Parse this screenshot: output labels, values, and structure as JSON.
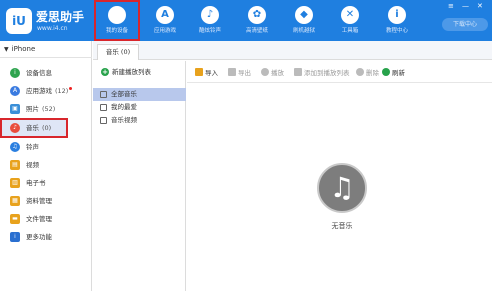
{
  "app": {
    "name": "爱思助手",
    "url": "www.i4.cn"
  },
  "nav": [
    {
      "label": "我的设备",
      "icon": "apple-icon",
      "glyph": ""
    },
    {
      "label": "应用游戏",
      "icon": "app-store-icon",
      "glyph": "A"
    },
    {
      "label": "酷炫铃声",
      "icon": "bell-icon",
      "glyph": "♪"
    },
    {
      "label": "高清壁纸",
      "icon": "wallpaper-icon",
      "glyph": "✿"
    },
    {
      "label": "刷机越狱",
      "icon": "dropbox-icon",
      "glyph": "◆"
    },
    {
      "label": "工具箱",
      "icon": "tools-icon",
      "glyph": "✕"
    },
    {
      "label": "教程中心",
      "icon": "info-icon",
      "glyph": "i"
    }
  ],
  "window_controls": {
    "menu": "≡",
    "minimize": "—",
    "close": "✕"
  },
  "download_button": "下载中心",
  "sidebar": {
    "device": "iPhone",
    "items": [
      {
        "label": "设备信息",
        "count": "",
        "icon": "info-icon",
        "color": "#2ea44f"
      },
      {
        "label": "应用游戏",
        "count": "(12)",
        "icon": "apps-icon",
        "color": "#3a7be0"
      },
      {
        "label": "照片",
        "count": "(52)",
        "icon": "photo-icon",
        "color": "#3a8fd8"
      },
      {
        "label": "音乐",
        "count": "(0)",
        "icon": "music-icon",
        "color": "#e94c3d"
      },
      {
        "label": "铃声",
        "count": "",
        "icon": "bell-icon",
        "color": "#2a7fe0"
      },
      {
        "label": "视频",
        "count": "",
        "icon": "video-icon",
        "color": "#e8a21d"
      },
      {
        "label": "电子书",
        "count": "",
        "icon": "ebook-icon",
        "color": "#e8a21d"
      },
      {
        "label": "资料管理",
        "count": "",
        "icon": "data-icon",
        "color": "#e8a21d"
      },
      {
        "label": "文件管理",
        "count": "",
        "icon": "folder-icon",
        "color": "#e8a21d"
      },
      {
        "label": "更多功能",
        "count": "",
        "icon": "more-icon",
        "color": "#2a6fd0"
      }
    ]
  },
  "tab": "音乐 (0)",
  "new_playlist": "新建播放列表",
  "playlists": [
    {
      "label": "全部音乐"
    },
    {
      "label": "我的最爱"
    },
    {
      "label": "音乐视频"
    }
  ],
  "toolbar": [
    {
      "label": "导入",
      "icon": "import-icon",
      "color": "#e8a21d",
      "enabled": true
    },
    {
      "label": "导出",
      "icon": "export-icon",
      "color": "#bbbbbb",
      "enabled": false
    },
    {
      "label": "播放",
      "icon": "play-icon",
      "color": "#bbbbbb",
      "enabled": false
    },
    {
      "label": "添加到播放列表",
      "icon": "add-to-playlist-icon",
      "color": "#bbbbbb",
      "enabled": false
    },
    {
      "label": "删除",
      "icon": "delete-icon",
      "color": "#bbbbbb",
      "enabled": false
    },
    {
      "label": "刷新",
      "icon": "refresh-icon",
      "color": "#27a24b",
      "enabled": true
    }
  ],
  "empty": {
    "text": "无音乐",
    "icon": "music-note-icon",
    "glyph": "♫"
  }
}
